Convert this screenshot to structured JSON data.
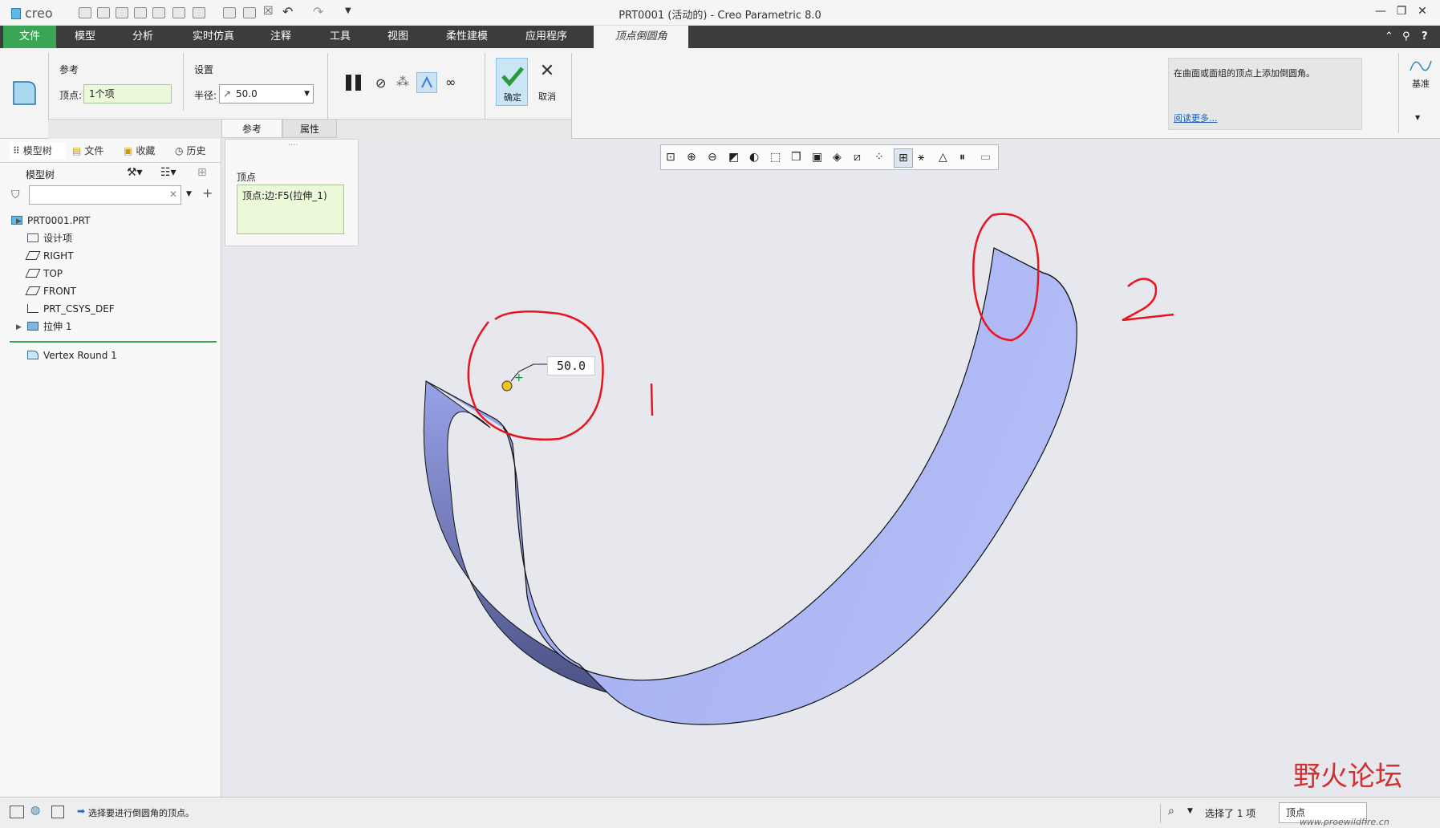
{
  "window": {
    "app_logo": "creo",
    "title": "PRT0001 (活动的) - Creo Parametric 8.0",
    "minimize_icon": "minimize-icon",
    "maximize_icon": "maximize-icon",
    "close_icon": "close-icon"
  },
  "menu": {
    "tabs": [
      {
        "label": "文件"
      },
      {
        "label": "模型"
      },
      {
        "label": "分析"
      },
      {
        "label": "实时仿真"
      },
      {
        "label": "注释"
      },
      {
        "label": "工具"
      },
      {
        "label": "视图"
      },
      {
        "label": "柔性建模"
      },
      {
        "label": "应用程序"
      },
      {
        "label": "顶点倒圆角"
      }
    ]
  },
  "ribbon": {
    "references_group_label": "参考",
    "vertex_label": "顶点:",
    "vertex_value": "1个项",
    "settings_group_label": "设置",
    "radius_label": "半径:",
    "radius_value": "50.0",
    "ok_label": "确定",
    "cancel_label": "取消",
    "subtabs": [
      {
        "label": "参考"
      },
      {
        "label": "属性"
      }
    ],
    "help_text": "在曲面或面组的顶点上添加倒圆角。",
    "help_link": "阅读更多...",
    "datum_label": "基准"
  },
  "ref_panel": {
    "title": "顶点",
    "item": "顶点:边:F5(拉伸_1)"
  },
  "left_panel": {
    "tabs": [
      {
        "label": "模型树"
      },
      {
        "label": "文件"
      },
      {
        "label": "收藏"
      },
      {
        "label": "历史"
      }
    ],
    "tree_header": "模型树",
    "search_placeholder": "",
    "tree": [
      {
        "label": "PRT0001.PRT"
      },
      {
        "label": "设计项"
      },
      {
        "label": "RIGHT"
      },
      {
        "label": "TOP"
      },
      {
        "label": "FRONT"
      },
      {
        "label": "PRT_CSYS_DEF"
      },
      {
        "label": "拉伸 1"
      },
      {
        "label": "Vertex Round 1"
      }
    ]
  },
  "graphics": {
    "dimension_value": "50.0",
    "annotation_1": "1",
    "annotation_2": "2",
    "surface_color": "#a9b4f2",
    "annotation_color": "#e8141e"
  },
  "status": {
    "message": "选择要进行倒圆角的顶点。",
    "selected_count": "选择了 1 项",
    "filter_value": "顶点",
    "watermark_title": "野火论坛",
    "watermark_url": "www.proewildfire.cn"
  }
}
